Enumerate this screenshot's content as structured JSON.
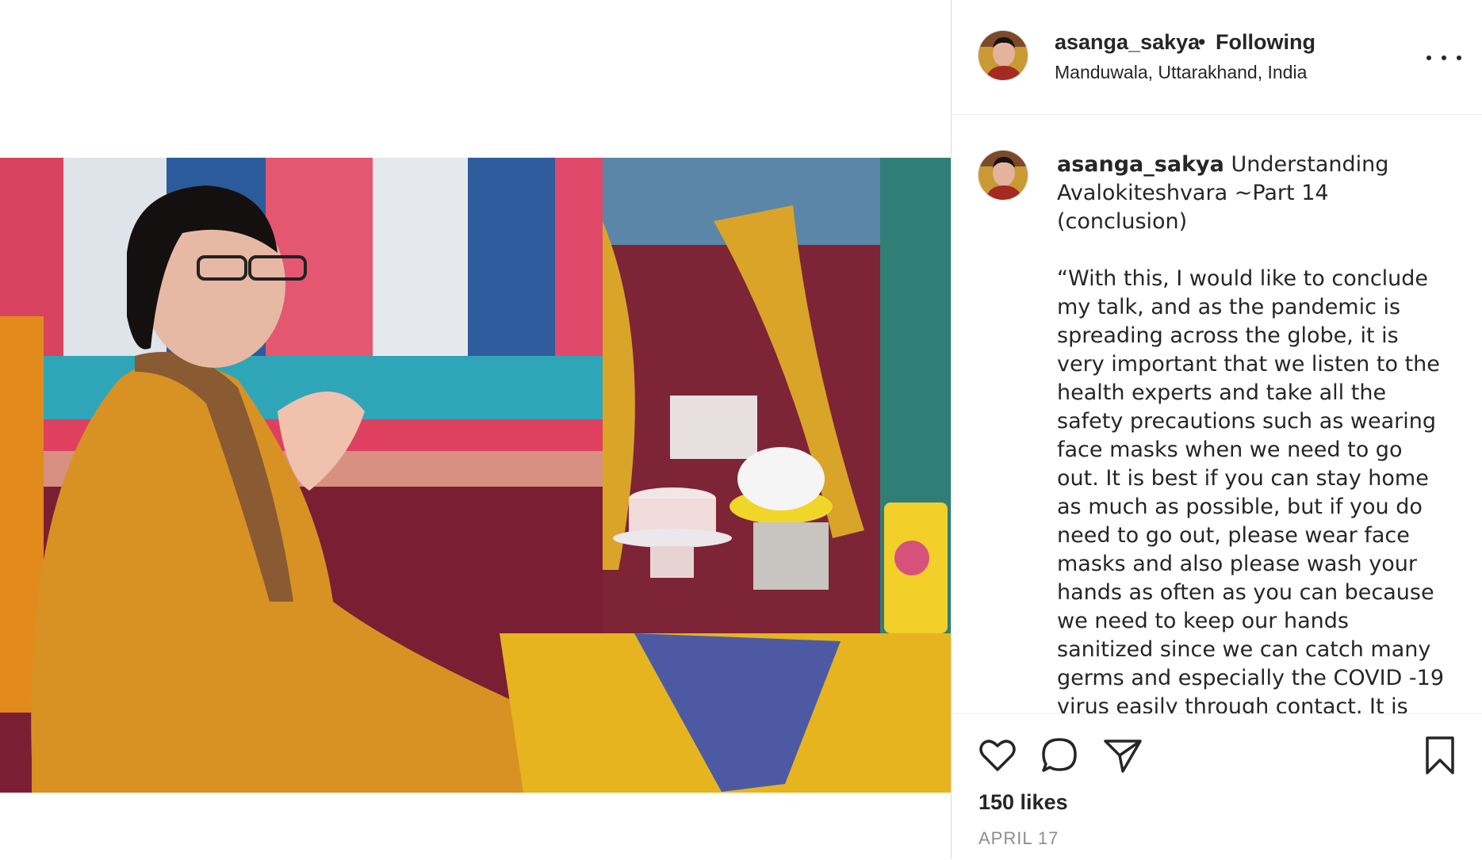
{
  "post": {
    "username": "asanga_sakya",
    "follow_separator": "•",
    "follow_status": "Following",
    "location": "Manduwala, Uttarakhand, India",
    "caption_title": "Understanding Avalokiteshvara ~Part 14 (conclusion)",
    "caption_body": "“With this, I would like to conclude my talk, and as the pandemic is spreading across the globe, it is very important that we listen to the health experts and take all the safety precautions such as wearing face masks when we need to go out. It is best if you can stay home as much as possible, but if you do need to go out, please wear face masks and also please wash your hands as often as you can because we need to keep our hands sanitized since we can catch many germs and especially the COVID -19 virus easily through contact. It is important that we think of others as much as we think of ourselves, and even if we do",
    "likes": "150 likes",
    "date": "APRIL 17"
  },
  "icons": {
    "more": "more-options-icon",
    "like": "heart-icon",
    "comment": "comment-icon",
    "share": "send-icon",
    "save": "bookmark-icon"
  },
  "colors": {
    "text": "#262626",
    "muted": "#8e8e8e",
    "border": "#dbdbdb"
  }
}
